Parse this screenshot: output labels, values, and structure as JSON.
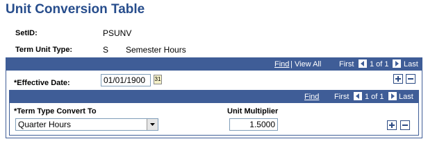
{
  "page": {
    "title": "Unit Conversion Table"
  },
  "header": {
    "setid_label": "SetID:",
    "setid_value": "PSUNV",
    "term_unit_type_label": "Term Unit Type:",
    "term_unit_type_code": "S",
    "term_unit_type_desc": "Semester Hours"
  },
  "outer_grid": {
    "find": "Find",
    "separator": "|",
    "view_all": "View All",
    "first": "First",
    "range": "1 of 1",
    "last": "Last",
    "effective_date_label": "*Effective Date:",
    "effective_date_value": "01/01/1900",
    "calendar_glyph": "31"
  },
  "inner_grid": {
    "find": "Find",
    "first": "First",
    "range": "1 of 1",
    "last": "Last",
    "col_term_type_convert_to": "*Term Type Convert To",
    "col_unit_multiplier": "Unit Multiplier",
    "term_type_value": "Quarter Hours",
    "unit_multiplier_value": "1.5000"
  }
}
